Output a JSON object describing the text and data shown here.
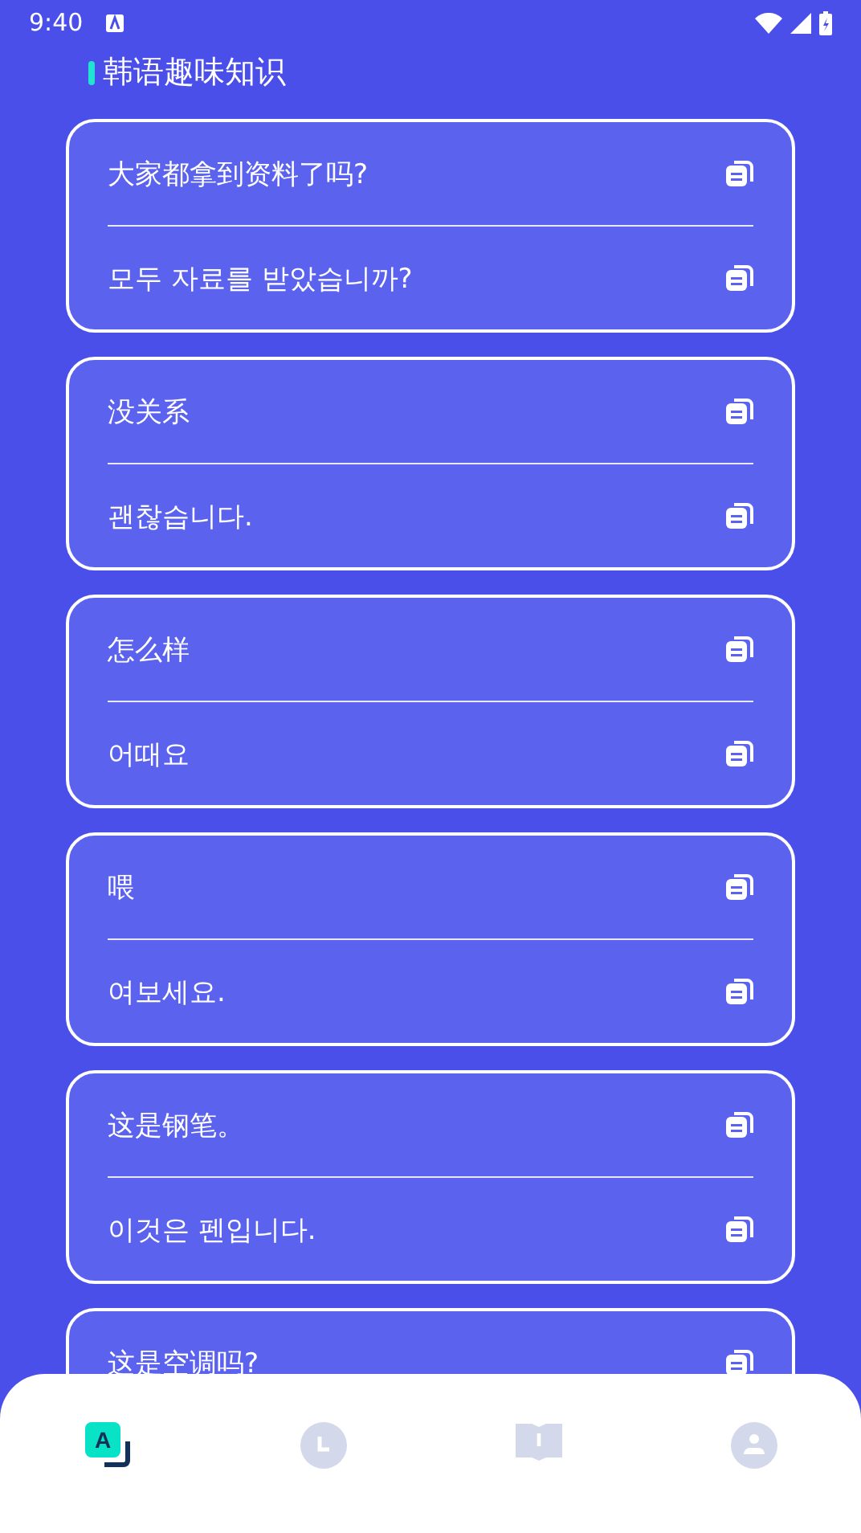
{
  "status_bar": {
    "time": "9:40"
  },
  "header": {
    "title": "韩语趣味知识"
  },
  "cards": [
    {
      "lines": [
        "大家都拿到资料了吗?",
        "모두 자료를 받았습니까?"
      ]
    },
    {
      "lines": [
        "没关系",
        "괜찮습니다."
      ]
    },
    {
      "lines": [
        "怎么样",
        "어때요"
      ]
    },
    {
      "lines": [
        "喂",
        "여보세요."
      ]
    },
    {
      "lines": [
        "这是钢笔。",
        "이것은 펜입니다."
      ]
    },
    {
      "lines": [
        "这是空调吗?"
      ]
    }
  ],
  "nav": [
    {
      "kind": "translate",
      "glyph": "A",
      "selected": true
    },
    {
      "kind": "clock",
      "selected": false
    },
    {
      "kind": "book",
      "selected": false
    },
    {
      "kind": "person",
      "selected": false
    }
  ]
}
